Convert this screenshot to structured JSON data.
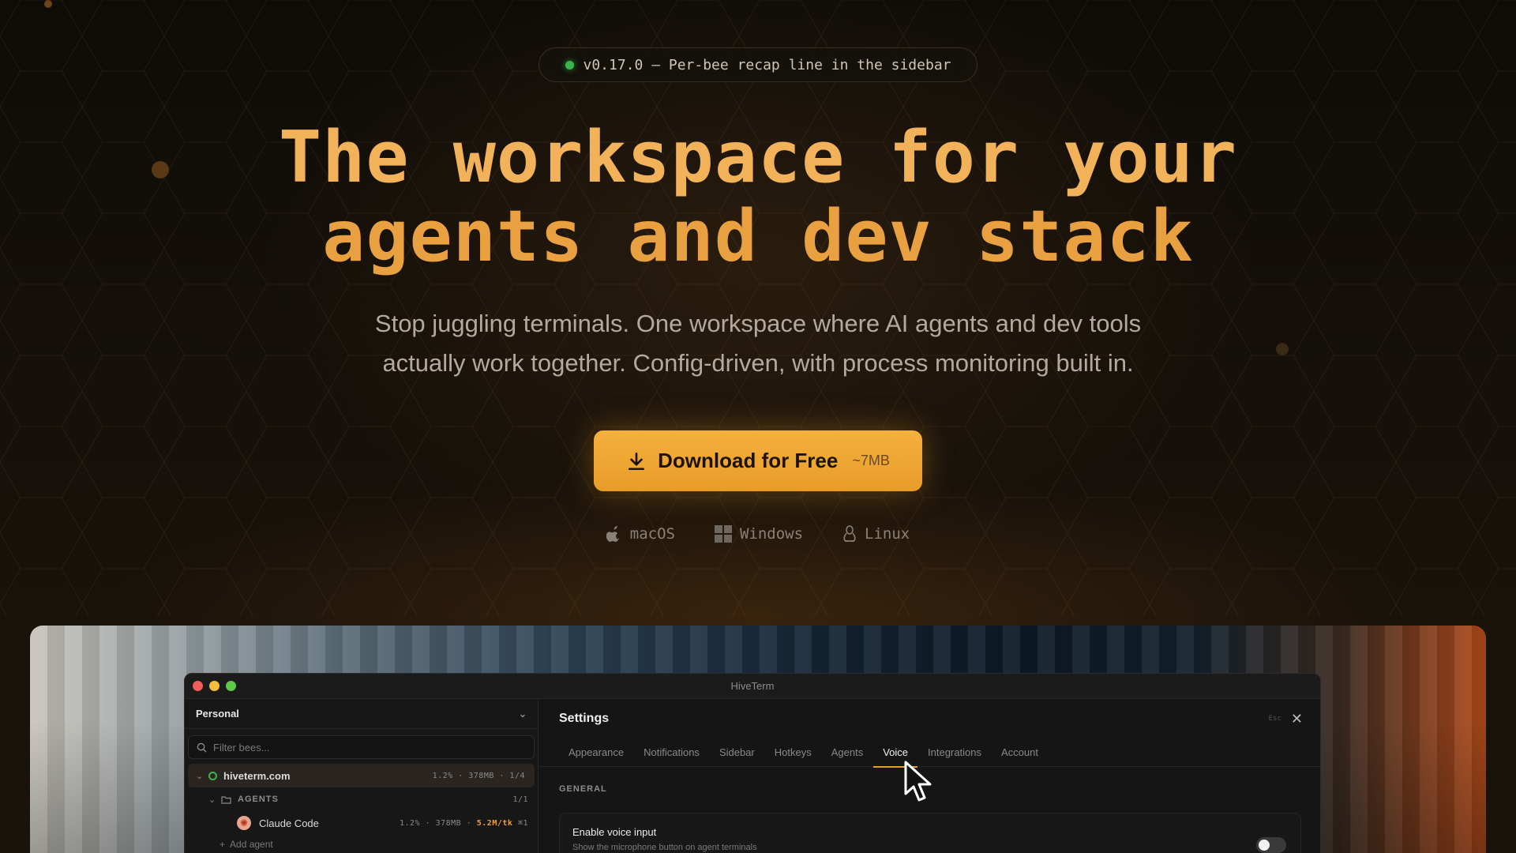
{
  "badge": {
    "text": "v0.17.0 — Per-bee recap line in the sidebar"
  },
  "hero": {
    "headline_line1": "The workspace for your",
    "headline_line2": "agents and dev stack",
    "subtitle_line1": "Stop juggling terminals. One workspace where AI agents and dev tools",
    "subtitle_line2": "actually work together. Config-driven, with process monitoring built in."
  },
  "download": {
    "label": "Download for Free",
    "size": "~7MB",
    "icon": "download-icon"
  },
  "platforms": [
    {
      "label": "macOS",
      "icon": "apple-icon"
    },
    {
      "label": "Windows",
      "icon": "windows-icon"
    },
    {
      "label": "Linux",
      "icon": "linux-icon"
    }
  ],
  "app": {
    "title": "HiveTerm",
    "sidebar": {
      "workspace": "Personal",
      "filter_placeholder": "Filter bees...",
      "project": {
        "name": "hiveterm.com",
        "meta": "1.2% · 378MB · 1/4"
      },
      "agents_group": {
        "label": "AGENTS",
        "count": "1/1"
      },
      "agent": {
        "name": "Claude Code",
        "meta": "1.2% · 378MB ·",
        "tokens": "5.2M/tk",
        "hotkey": "⌘1"
      },
      "add_agent": "Add agent"
    },
    "settings": {
      "title": "Settings",
      "esc_hint": "Esc",
      "tabs": [
        "Appearance",
        "Notifications",
        "Sidebar",
        "Hotkeys",
        "Agents",
        "Voice",
        "Integrations",
        "Account"
      ],
      "active_tab": "Voice",
      "section": "GENERAL",
      "voice_input": {
        "name": "Enable voice input",
        "description": "Show the microphone button on agent terminals",
        "enabled": false
      }
    }
  },
  "colors": {
    "accent": "#e89c28",
    "headline": "#f2b25a",
    "status_green": "#3bb54a"
  }
}
